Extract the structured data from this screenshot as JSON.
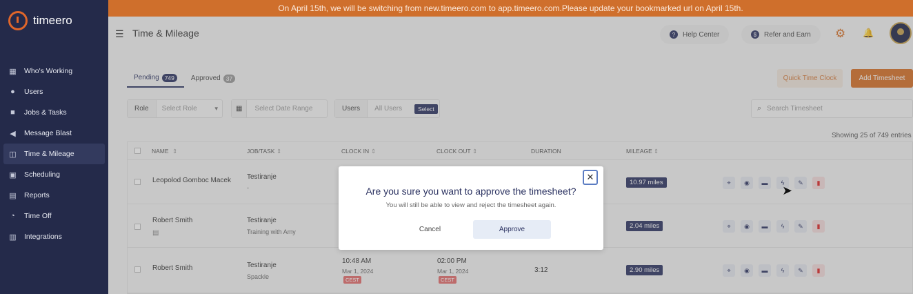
{
  "brand": {
    "name": "timeero",
    "accent": "#d66d22",
    "navy": "#2a3160"
  },
  "banner": {
    "text": "On April 15th, we will be switching from new.timeero.com to app.timeero.com.Please update your bookmarked url on April 15th."
  },
  "sidebar": {
    "items": [
      {
        "label": "Who's Working",
        "icon": "map-icon"
      },
      {
        "label": "Users",
        "icon": "users-icon"
      },
      {
        "label": "Jobs & Tasks",
        "icon": "briefcase-icon"
      },
      {
        "label": "Message Blast",
        "icon": "megaphone-icon"
      },
      {
        "label": "Time & Mileage",
        "icon": "timesheet-icon",
        "active": true
      },
      {
        "label": "Scheduling",
        "icon": "calendar-icon"
      },
      {
        "label": "Reports",
        "icon": "reports-icon"
      },
      {
        "label": "Time Off",
        "icon": "time-off-icon"
      },
      {
        "label": "Integrations",
        "icon": "integrations-icon"
      }
    ]
  },
  "header": {
    "title": "Time & Mileage",
    "help_label": "Help Center",
    "refer_label": "Refer and Earn"
  },
  "tabs": [
    {
      "label": "Pending",
      "count": "749"
    },
    {
      "label": "Approved",
      "count": "37"
    }
  ],
  "toolbar": {
    "quick_time_clock": "Quick Time Clock",
    "add_timesheet": "Add Timesheet"
  },
  "filters": {
    "role_label": "Role",
    "role_placeholder": "Select Role",
    "date_placeholder": "Select Date Range",
    "users_label": "Users",
    "users_value": "All Users",
    "users_select": "Select",
    "search_placeholder": "Search Timesheet"
  },
  "showing": "Showing 25 of 749 entries",
  "table": {
    "columns": [
      "NAME",
      "JOB/TASK",
      "CLOCK IN",
      "CLOCK OUT",
      "DURATION",
      "MILEAGE"
    ],
    "rows": [
      {
        "name": "Leopolod Gomboc Macek",
        "job": "Testiranje",
        "task": "-",
        "mileage": "10.97 miles"
      },
      {
        "name": "Robert Smith",
        "job": "Testiranje",
        "task": "Training with Amy",
        "mileage": "2.04 miles"
      },
      {
        "name": "Robert Smith",
        "job": "Testiranje",
        "task": "Spackle",
        "clock_in": "10:48 AM",
        "clock_in_date": "Mar 1, 2024",
        "clock_in_tz": "CEST",
        "clock_out": "02:00 PM",
        "clock_out_date": "Mar 1, 2024",
        "clock_out_tz": "CEST",
        "duration": "3:12",
        "mileage": "2.90 miles"
      }
    ]
  },
  "modal": {
    "title": "Are you sure you want to approve the timesheet?",
    "text": "You will still be able to view and reject the timesheet again.",
    "cancel": "Cancel",
    "approve": "Approve"
  }
}
